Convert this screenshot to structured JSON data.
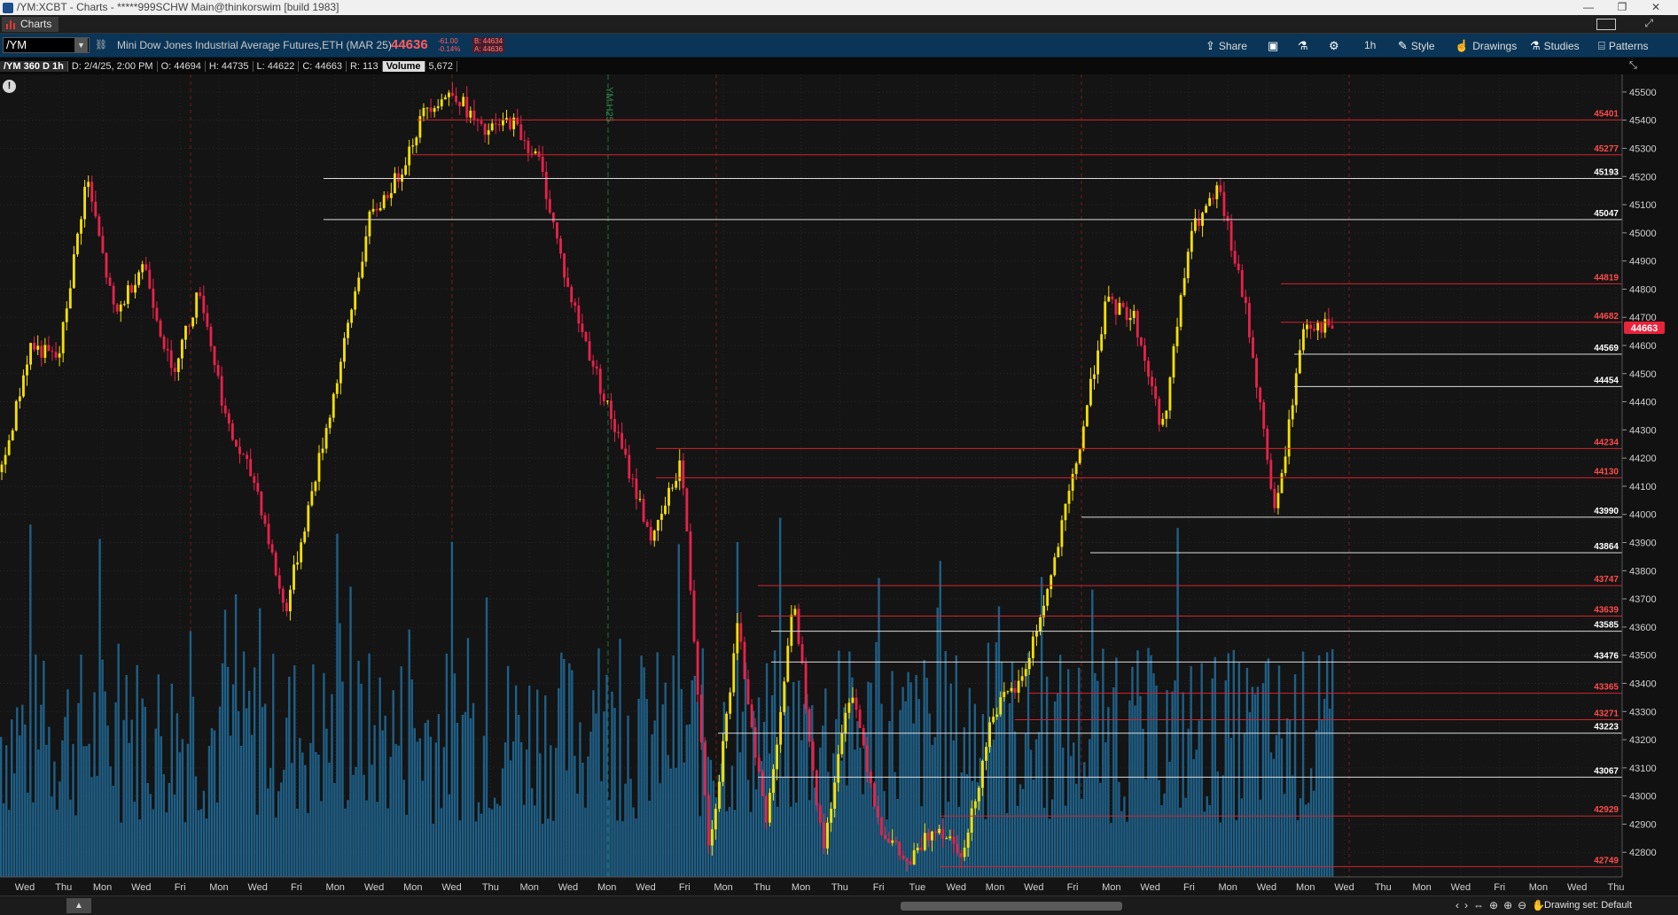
{
  "window": {
    "title": "/YM:XCBT - Charts - *****999SCHW Main@thinkorswim [build 1983]",
    "controls": [
      "—",
      "❐",
      "✕"
    ]
  },
  "tab": {
    "label": "Charts"
  },
  "toolbar": {
    "symbol": "/YM",
    "description": "Mini Dow Jones Industrial Average Futures,ETH (MAR 25)",
    "last_price": "44636",
    "change": "-61.00",
    "change_pct": "-0.14%",
    "bid": "B: 44634",
    "ask": "A: 44636",
    "share_label": "Share",
    "aggregation": "1h",
    "style_label": "Style",
    "drawings_label": "Drawings",
    "studies_label": "Studies",
    "patterns_label": "Patterns"
  },
  "infobar": {
    "symbol": "/YM 360 D 1h",
    "date": "D: 2/4/25, 2:00 PM",
    "open": "O: 44694",
    "high": "H: 44735",
    "low": "L: 44622",
    "close": "C: 44663",
    "range": "R: 113",
    "volume_label": "Volume",
    "volume_value": "5,672"
  },
  "bottombar": {
    "drawing_set": "Drawing set: Default"
  },
  "colors": {
    "background": "#141414",
    "up_bar": "#f5e000",
    "down_bar": "#e8224a",
    "volume": "#1f5f86",
    "level_red": "#d2242e",
    "level_white": "#dcdcdc",
    "price_tag": "#e8233a"
  },
  "chart_data": {
    "type": "candlestick",
    "aggregation": "1h",
    "period": "360 D",
    "y_axis_side": "right",
    "ylim": [
      42700,
      45550
    ],
    "y_ticks": [
      42800,
      42900,
      43000,
      43100,
      43200,
      43300,
      43400,
      43500,
      43600,
      43700,
      43800,
      43900,
      44000,
      44100,
      44200,
      44300,
      44400,
      44500,
      44600,
      44700,
      44800,
      44900,
      45000,
      45100,
      45200,
      45300,
      45400,
      45500
    ],
    "x_tick_labels": [
      "Wed",
      "Thu",
      "Mon",
      "Wed",
      "Fri",
      "Mon",
      "Wed",
      "Fri",
      "Mon",
      "Wed",
      "Mon",
      "Wed",
      "Thu",
      "Mon",
      "Wed",
      "Mon",
      "Wed",
      "Fri",
      "Mon",
      "Thu",
      "Mon",
      "Thu",
      "Fri",
      "Tue",
      "Wed",
      "Mon",
      "Wed",
      "Fri",
      "Mon",
      "Wed",
      "Fri",
      "Mon",
      "Wed",
      "Mon",
      "Wed",
      "Thu",
      "Mon",
      "Wed",
      "Fri",
      "Mon",
      "Wed",
      "Thu"
    ],
    "vertical_annotation": "YM:H25",
    "current_price": 44663,
    "price_levels": [
      {
        "value": 45401,
        "label": "45401",
        "color": "red"
      },
      {
        "value": 45277,
        "label": "45277",
        "color": "red"
      },
      {
        "value": 45193,
        "label": "45193",
        "color": "white"
      },
      {
        "value": 45047,
        "label": "45047",
        "color": "white"
      },
      {
        "value": 44819,
        "label": "44819",
        "color": "red"
      },
      {
        "value": 44682,
        "label": "44682",
        "color": "red"
      },
      {
        "value": 44569,
        "label": "44569",
        "color": "white"
      },
      {
        "value": 44454,
        "label": "44454",
        "color": "white"
      },
      {
        "value": 44234,
        "label": "44234",
        "color": "red"
      },
      {
        "value": 44130,
        "label": "44130",
        "color": "red"
      },
      {
        "value": 43990,
        "label": "43990",
        "color": "white"
      },
      {
        "value": 43864,
        "label": "43864",
        "color": "white"
      },
      {
        "value": 43747,
        "label": "43747",
        "color": "red"
      },
      {
        "value": 43639,
        "label": "43639",
        "color": "red"
      },
      {
        "value": 43585,
        "label": "43585",
        "color": "white"
      },
      {
        "value": 43476,
        "label": "43476",
        "color": "white"
      },
      {
        "value": 43365,
        "label": "43365",
        "color": "red"
      },
      {
        "value": 43271,
        "label": "43271",
        "color": "red"
      },
      {
        "value": 43223,
        "label": "43223",
        "color": "white"
      },
      {
        "value": 43067,
        "label": "43067",
        "color": "white"
      },
      {
        "value": 42929,
        "label": "42929",
        "color": "red"
      },
      {
        "value": 42749,
        "label": "42749",
        "color": "red"
      }
    ],
    "price_path": [
      44150,
      44600,
      44550,
      45200,
      44700,
      44900,
      44500,
      44800,
      44300,
      44100,
      43650,
      44100,
      44550,
      45050,
      45200,
      45450,
      45500,
      45350,
      45400,
      45250,
      44800,
      44500,
      44200,
      43900,
      44200,
      42800,
      43600,
      42900,
      43700,
      42800,
      43400,
      42900,
      42750,
      42900,
      42800,
      43300,
      43400,
      43750,
      44200,
      44750,
      44700,
      44300,
      45000,
      45150,
      44700,
      43990,
      44682,
      44663
    ]
  }
}
